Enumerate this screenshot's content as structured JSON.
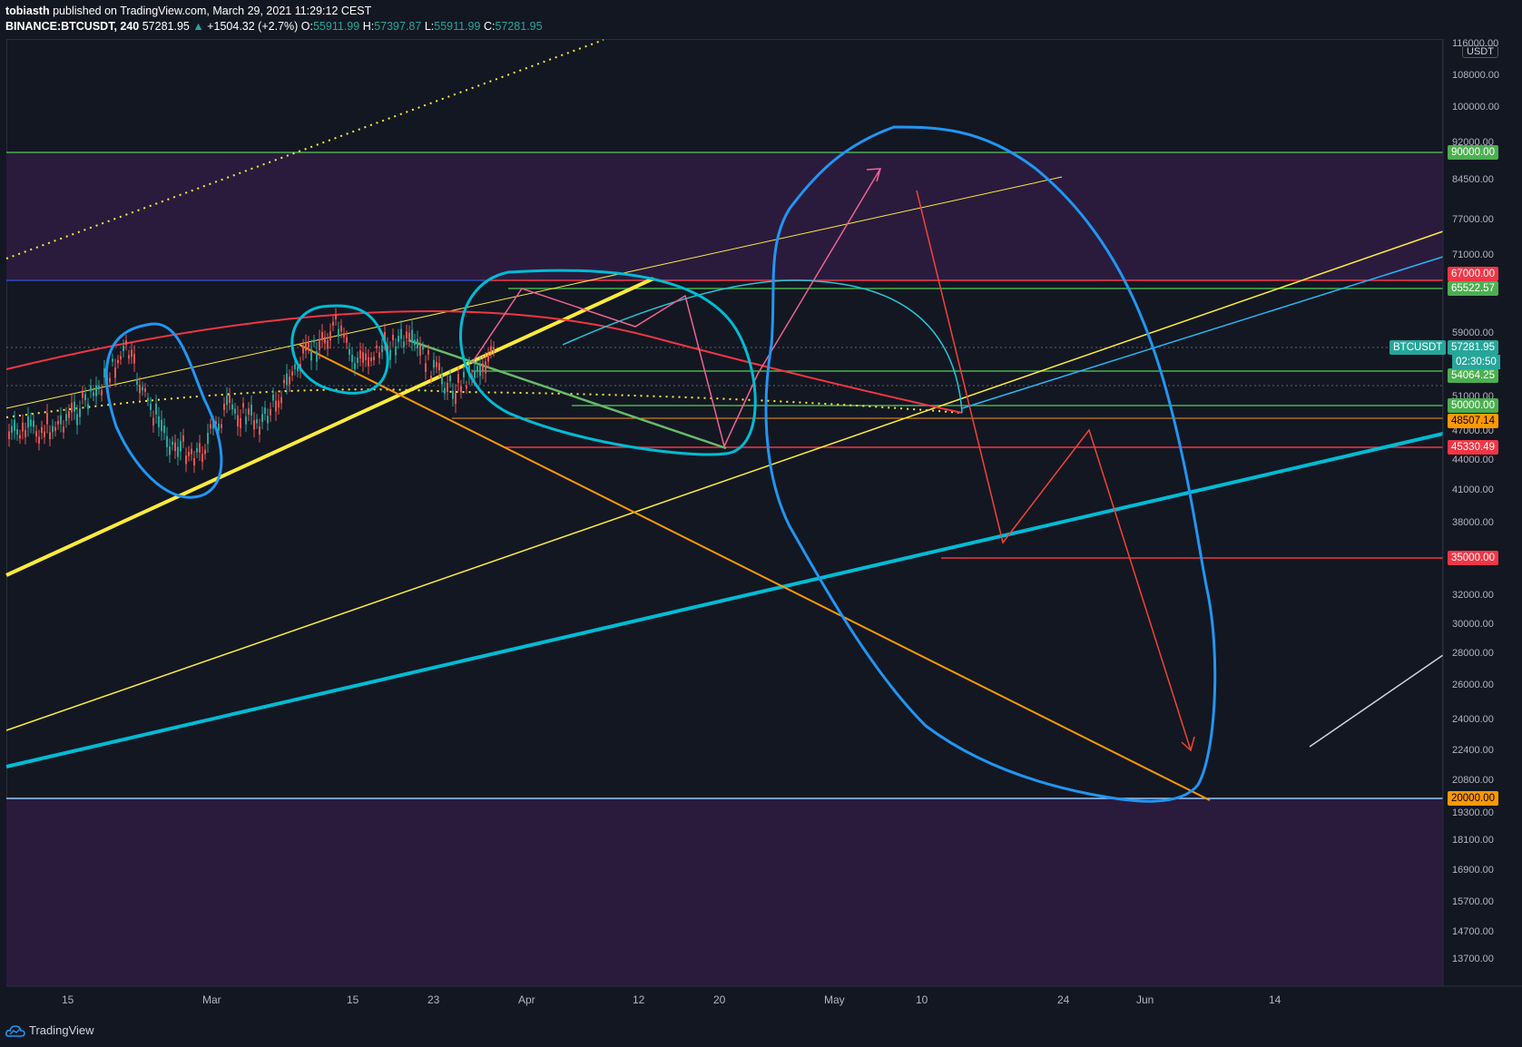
{
  "header": {
    "author": "tobiasth",
    "published": "published on TradingView.com, March 29, 2021 11:29:12 CEST",
    "symbol": "BINANCE:BTCUSDT, 240",
    "last": "57281.95",
    "change": "+1504.32 (+2.7%)",
    "o_label": "O:",
    "o": "55911.99",
    "h_label": "H:",
    "h": "57397.87",
    "l_label": "L:",
    "l": "55911.99",
    "c_label": "C:",
    "c": "57281.95"
  },
  "price_axis": {
    "unit": "USDT",
    "labels": [
      "116000.00",
      "108000.00",
      "100000.00",
      "92000.00",
      "84500.00",
      "77000.00",
      "71000.00",
      "59000.00",
      "51000.00",
      "47000.00",
      "44000.00",
      "41000.00",
      "38000.00",
      "32000.00",
      "30000.00",
      "28000.00",
      "26000.00",
      "24000.00",
      "22400.00",
      "20800.00",
      "19300.00",
      "18100.00",
      "16900.00",
      "15700.00",
      "14700.00",
      "13700.00"
    ]
  },
  "price_tags": [
    {
      "value": "90000.00",
      "color": "#4caf50"
    },
    {
      "value": "67000.00",
      "color": "#f23645"
    },
    {
      "value": "65522.57",
      "color": "#4caf50"
    },
    {
      "value": "57281.95",
      "color": "#26a69a"
    },
    {
      "value": "54064.25",
      "color": "#4caf50"
    },
    {
      "value": "50000.00",
      "color": "#4caf50"
    },
    {
      "value": "48507.14",
      "color": "#ff9800"
    },
    {
      "value": "45330.49",
      "color": "#f23645"
    },
    {
      "value": "35000.00",
      "color": "#f23645"
    },
    {
      "value": "20000.00",
      "color": "#ff9800"
    }
  ],
  "symbol_tag": "BTCUSDT",
  "timer": "02:30:50",
  "time_axis": [
    "15",
    "Mar",
    "15",
    "23",
    "Apr",
    "12",
    "20",
    "May",
    "10",
    "24",
    "Jun",
    "14"
  ],
  "footer": {
    "brand": "TradingView"
  },
  "colors": {
    "background": "#131722",
    "zone": "#2a1b3d",
    "green_line": "#4caf50",
    "red_line": "#f23645",
    "yellow_line": "#ffeb3b",
    "cyan_line": "#00bcd4",
    "blue_drawing": "#2196f3",
    "orange_line": "#ff9800",
    "pink_path": "#f06292"
  }
}
